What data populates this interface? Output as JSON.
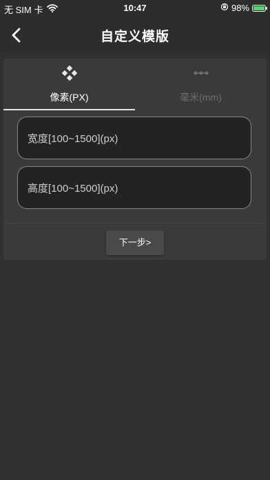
{
  "status_bar": {
    "carrier": "无 SIM 卡",
    "time": "10:47",
    "battery_percent": "98%",
    "battery_level": 0.98,
    "icons": [
      "wifi-icon",
      "orientation-lock-icon",
      "battery-charging-icon"
    ]
  },
  "nav": {
    "title": "自定义模版",
    "back_icon": "chevron-left-icon"
  },
  "tabs": [
    {
      "label": "像素(PX)",
      "icon": "diamond-grid-icon",
      "active": true
    },
    {
      "label": "毫米(mm)",
      "icon": "ruler-dots-icon",
      "active": false
    }
  ],
  "form": {
    "width_placeholder": "宽度[100~1500](px)",
    "height_placeholder": "高度[100~1500](px)",
    "width_value": "",
    "height_value": ""
  },
  "actions": {
    "next_label": "下一步>"
  },
  "colors": {
    "background": "#303030",
    "card": "#3a3a3a",
    "input_bg": "#232323",
    "active_text": "#ffffff",
    "inactive_text": "#6e6e6e",
    "battery": "#4cd964"
  }
}
